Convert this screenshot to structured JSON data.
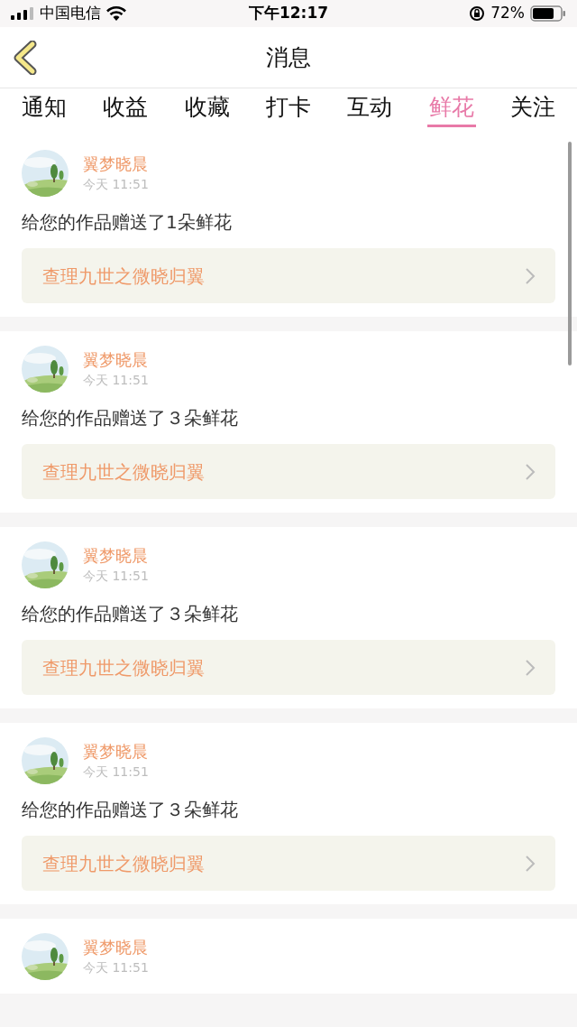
{
  "status_bar": {
    "carrier": "中国电信",
    "time": "下午12:17",
    "battery": "72%"
  },
  "title": "消息",
  "tabs": [
    {
      "label": "通知",
      "selected": false
    },
    {
      "label": "收益",
      "selected": false
    },
    {
      "label": "收藏",
      "selected": false
    },
    {
      "label": "打卡",
      "selected": false
    },
    {
      "label": "互动",
      "selected": false
    },
    {
      "label": "鲜花",
      "selected": true
    },
    {
      "label": "关注",
      "selected": false
    }
  ],
  "messages": [
    {
      "user": "翼梦晓晨",
      "time": "今天 11:51",
      "text": "给您的作品赠送了1朵鲜花",
      "work": "查理九世之微晓归翼"
    },
    {
      "user": "翼梦晓晨",
      "time": "今天 11:51",
      "text": "给您的作品赠送了３朵鲜花",
      "work": "查理九世之微晓归翼"
    },
    {
      "user": "翼梦晓晨",
      "time": "今天 11:51",
      "text": "给您的作品赠送了３朵鲜花",
      "work": "查理九世之微晓归翼"
    },
    {
      "user": "翼梦晓晨",
      "time": "今天 11:51",
      "text": "给您的作品赠送了３朵鲜花",
      "work": "查理九世之微晓归翼"
    },
    {
      "user": "翼梦晓晨",
      "time": "今天 11:51"
    }
  ]
}
